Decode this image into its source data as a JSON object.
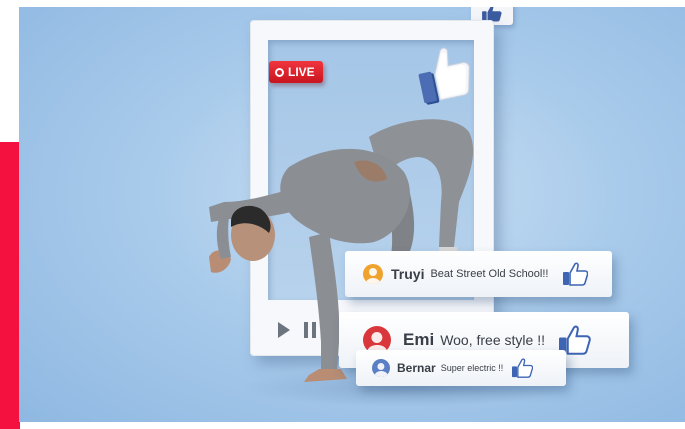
{
  "live_badge": {
    "label": "LIVE",
    "color": "#e3232d"
  },
  "accent_color": "#f4113f",
  "like_icon": "thumbs-up-icon",
  "player_controls": {
    "play": "play-icon",
    "pause": "pause-icon"
  },
  "comments": [
    {
      "name": "Truyi",
      "text": "Beat Street Old School!!",
      "avatar_color": "#f0a22e",
      "icon": "thumbs-up-icon"
    },
    {
      "name": "Emi",
      "text": "Woo, free style !!",
      "avatar_color": "#d9373b",
      "icon": "thumbs-up-icon"
    },
    {
      "name": "Bernar",
      "text": "Super electric !!",
      "avatar_color": "#5b7fc4",
      "icon": "thumbs-up-icon"
    }
  ]
}
